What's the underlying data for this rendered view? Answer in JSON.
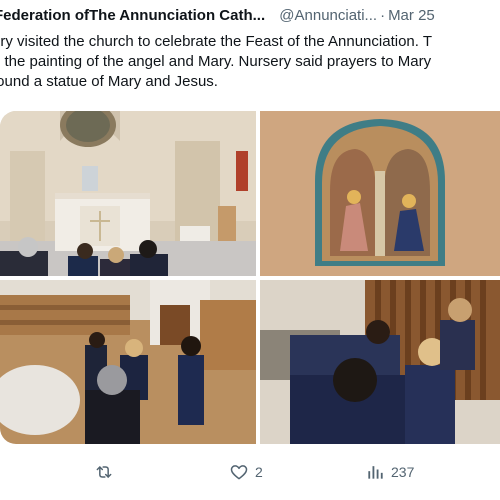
{
  "tweet": {
    "author": "Federation ofThe Annunciation Cath...",
    "handle": "@Annunciati...",
    "separator": "·",
    "date": "Mar 25",
    "lines": [
      "ery visited the church to celebrate the Feast of the Annunciation. T",
      "d the painting of the angel and Mary. Nursery said prayers to Mary",
      "found a statue of Mary and Jesus."
    ]
  },
  "media": {
    "photos": [
      {
        "name": "church-altar-photo"
      },
      {
        "name": "annunciation-painting-photo"
      },
      {
        "name": "church-pews-photo"
      },
      {
        "name": "statue-gate-photo"
      }
    ]
  },
  "actions": {
    "retweet_icon": "retweet-icon",
    "like_icon": "heart-icon",
    "like_count": "2",
    "views_icon": "views-chart-icon",
    "views_count": "237"
  },
  "colors": {
    "text": "#0f1419",
    "secondary": "#536471"
  }
}
